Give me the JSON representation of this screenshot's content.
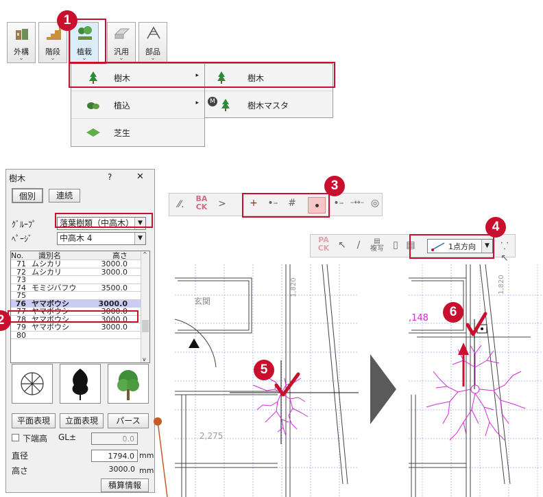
{
  "toolbar": {
    "buttons": [
      {
        "label": "外構",
        "arrow": "⌄",
        "icon": "exterior-icon"
      },
      {
        "label": "階段",
        "arrow": "⌄",
        "icon": "stairs-icon"
      },
      {
        "label": "植栽",
        "arrow": "⌄",
        "icon": "plant-icon"
      },
      {
        "label": "汎用",
        "arrow": "⌄",
        "icon": "generic-icon"
      },
      {
        "label": "部品",
        "arrow": "⌄",
        "icon": "parts-icon"
      }
    ]
  },
  "menu": {
    "items": [
      {
        "label": "樹木",
        "submenu": "▸"
      },
      {
        "label": "植込",
        "submenu": "▸"
      },
      {
        "label": "芝生"
      }
    ],
    "submenu_items": [
      {
        "label": "樹木"
      },
      {
        "label": "樹木マスタ",
        "badge": "M"
      }
    ]
  },
  "steps": [
    "1",
    "2",
    "3",
    "4",
    "5",
    "6"
  ],
  "dialog": {
    "title": "樹木",
    "help": "?",
    "close": "✕",
    "tabs": [
      "個別",
      "連続"
    ],
    "group_label": "ｸﾞﾙｰﾌﾟ",
    "group_value": "落葉樹類（中高木）",
    "page_label": "ﾍﾟｰｼﾞ",
    "page_value": "中高木 4",
    "columns": [
      "No.",
      "識別名",
      "高さ"
    ],
    "rows": [
      {
        "no": "71",
        "name": "ムシカリ",
        "height": "3000.0"
      },
      {
        "no": "72",
        "name": "ムシカリ",
        "height": "3000.0"
      },
      {
        "no": "73",
        "name": "",
        "height": ""
      },
      {
        "no": "74",
        "name": "モミジバフウ",
        "height": "3500.0"
      },
      {
        "no": "75",
        "name": "",
        "height": ""
      },
      {
        "no": "76",
        "name": "ヤマボウシ",
        "height": "3000.0"
      },
      {
        "no": "77",
        "name": "ヤマボウシ",
        "height": "3000.0"
      },
      {
        "no": "78",
        "name": "ヤマボウシ",
        "height": "3000.0"
      },
      {
        "no": "79",
        "name": "ヤマボウシ",
        "height": "3000.0"
      },
      {
        "no": "80",
        "name": "",
        "height": ""
      }
    ],
    "selected_row_index": 5,
    "buttons": [
      "平面表現",
      "立面表現",
      "パース"
    ],
    "bottom_label": "下端高",
    "bottom_unit": "GL±",
    "bottom_value": "0.0",
    "diameter_label": "直径",
    "diameter_value": "1794.0",
    "diameter_unit": "mm",
    "height_label": "高さ",
    "height_value": "3000.0",
    "height_unit": "mm",
    "cost_button": "積算情報"
  },
  "snap_toolbar": {
    "back_label": "BA\nCK",
    "icons": [
      "parallel-icon",
      "back-icon",
      "arrow-icon",
      "crosshair-icon",
      "line-end-icon",
      "grid-snap-icon",
      "point-icon",
      "endpoint-icon",
      "midpoint-icon",
      "circle-icon"
    ]
  },
  "place_toolbar": {
    "paste_label": "PA\nCK",
    "copy_label": "複写",
    "direction_value": "1点方向",
    "icons": [
      "paste-icon",
      "select-icon",
      "eyedropper-icon",
      "copy-icon",
      "page-icon",
      "list-icon",
      "line-direction-icon",
      "node-icon"
    ]
  },
  "plan_left": {
    "room_label": "玄関",
    "dim_vertical": "1,820",
    "dim_bottom": "2,275"
  },
  "plan_right": {
    "dim_partial": ",148",
    "dim_vertical": "1,820"
  },
  "colors": {
    "accent_red": "#c8102e",
    "tree_magenta": "#d12bd1",
    "grid_blue": "#9aa9e8",
    "arrow_gray": "#5a5a5a"
  }
}
